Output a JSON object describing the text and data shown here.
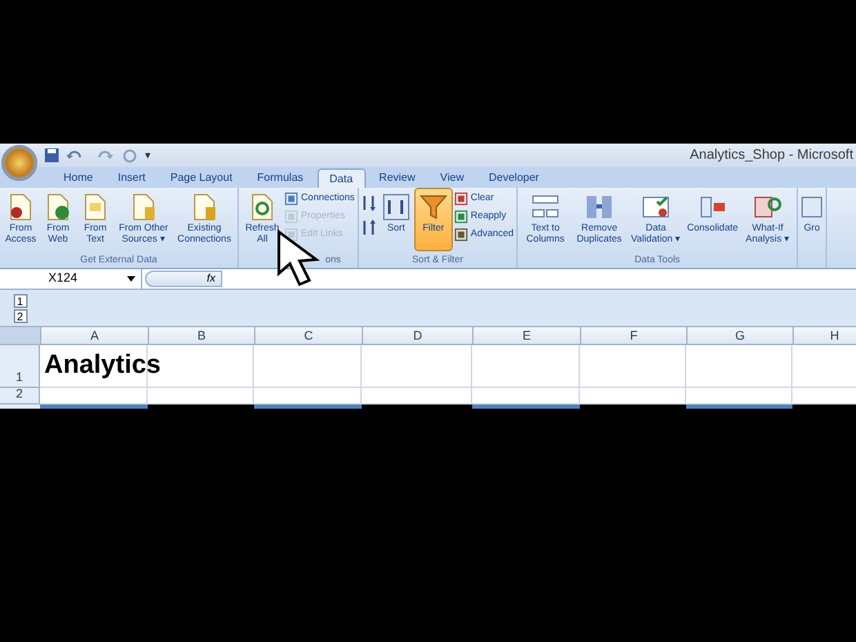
{
  "window": {
    "title": "Analytics_Shop - Microsoft"
  },
  "quick_access": {
    "more": "▾"
  },
  "tabs": [
    {
      "label": "Home",
      "selected": false
    },
    {
      "label": "Insert",
      "selected": false
    },
    {
      "label": "Page Layout",
      "selected": false
    },
    {
      "label": "Formulas",
      "selected": false
    },
    {
      "label": "Data",
      "selected": true
    },
    {
      "label": "Review",
      "selected": false
    },
    {
      "label": "View",
      "selected": false
    },
    {
      "label": "Developer",
      "selected": false
    }
  ],
  "ribbon": {
    "groups": [
      {
        "label": "Get External Data",
        "items": [
          {
            "kind": "large",
            "label": "From Access"
          },
          {
            "kind": "large",
            "label": "From Web"
          },
          {
            "kind": "large",
            "label": "From Text"
          },
          {
            "kind": "large",
            "label": "From Other Sources ▾"
          },
          {
            "kind": "large",
            "label": "Existing Connections"
          }
        ]
      },
      {
        "label": "ons",
        "items": [
          {
            "kind": "large",
            "label": "Refresh All"
          },
          {
            "kind": "stack",
            "entries": [
              {
                "label": "Connections",
                "disabled": false
              },
              {
                "label": "Properties",
                "disabled": true
              },
              {
                "label": "Edit Links",
                "disabled": true
              }
            ]
          }
        ]
      },
      {
        "label": "Sort & Filter",
        "items": [
          {
            "kind": "sortpair"
          },
          {
            "kind": "large",
            "label": "Sort"
          },
          {
            "kind": "large",
            "label": "Filter",
            "active": true
          },
          {
            "kind": "stack",
            "entries": [
              {
                "label": "Clear",
                "disabled": false
              },
              {
                "label": "Reapply",
                "disabled": false
              },
              {
                "label": "Advanced",
                "disabled": false
              }
            ]
          }
        ]
      },
      {
        "label": "Data Tools",
        "items": [
          {
            "kind": "large",
            "label": "Text to Columns"
          },
          {
            "kind": "large",
            "label": "Remove Duplicates"
          },
          {
            "kind": "large",
            "label": "Data Validation ▾"
          },
          {
            "kind": "large",
            "label": "Consolidate"
          },
          {
            "kind": "large",
            "label": "What-If Analysis ▾"
          }
        ]
      },
      {
        "items": [
          {
            "kind": "large",
            "label": "Gro"
          }
        ]
      }
    ]
  },
  "formula_bar": {
    "name_box": "X124",
    "fx": "fx"
  },
  "outline_levels": [
    "1",
    "2"
  ],
  "columns": [
    "A",
    "B",
    "C",
    "D",
    "E",
    "F",
    "G",
    "H"
  ],
  "rows": [
    {
      "header": "1",
      "cells": [
        "Analytics"
      ]
    },
    {
      "header": "2",
      "cells": []
    }
  ],
  "row_3_cells": [
    {
      "color": "#4f81bd"
    },
    {
      "color": "#000000"
    },
    {
      "color": "#4f81bd"
    },
    {
      "color": "#000000"
    },
    {
      "color": "#4f81bd"
    },
    {
      "color": "#000000"
    },
    {
      "color": "#4f81bd"
    },
    {
      "color": "#000000"
    }
  ]
}
